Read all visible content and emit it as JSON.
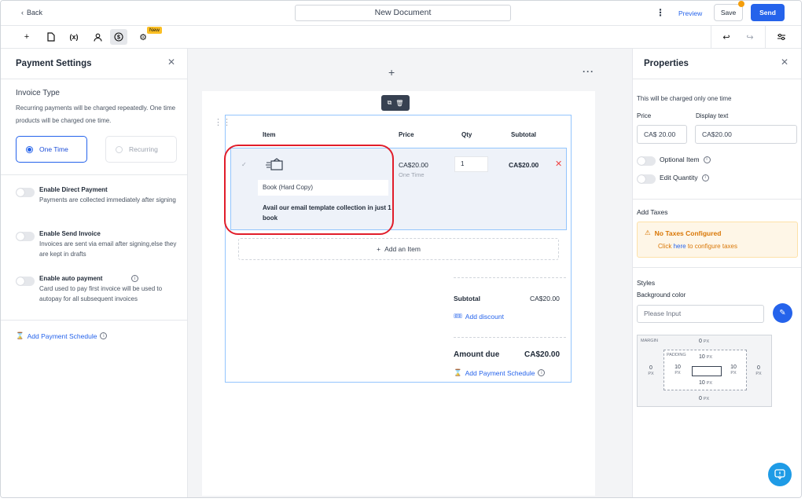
{
  "topbar": {
    "back_label": "Back",
    "document_title": "New Document",
    "preview_label": "Preview",
    "save_label": "Save",
    "send_label": "Send"
  },
  "toolbar": {
    "tools": [
      "plus-icon",
      "page-icon",
      "variable-icon",
      "user-icon",
      "dollar-icon",
      "gear-icon"
    ],
    "variable_glyph": "(x)",
    "new_badge": "New"
  },
  "payment_settings": {
    "title": "Payment Settings",
    "invoice_type_title": "Invoice Type",
    "invoice_type_desc": "Recurring payments will be charged repeatedly. One time products will be charged one time.",
    "option_one_time": "One Time",
    "option_recurring": "Recurring",
    "toggles": [
      {
        "label": "Enable Direct Payment",
        "desc": "Payments are collected immediately after signing"
      },
      {
        "label": "Enable Send Invoice",
        "desc": "Invoices are sent via email after signing,else they are kept in drafts"
      },
      {
        "label": "Enable auto payment",
        "desc": "Card used to pay first invoice will be used to autopay for all subsequent invoices"
      }
    ],
    "add_schedule_label": "Add Payment Schedule"
  },
  "product_table": {
    "headers": {
      "item": "Item",
      "price": "Price",
      "qty": "Qty",
      "subtotal": "Subtotal"
    },
    "rows": [
      {
        "name": "Book (Hard Copy)",
        "description": "Avail our email template collection in just 1 book",
        "price": "CA$20.00",
        "price_type": "One Time",
        "qty": "1",
        "subtotal": "CA$20.00"
      }
    ],
    "add_item_label": "Add an Item",
    "subtotal_label": "Subtotal",
    "subtotal_value": "CA$20.00",
    "add_discount_label": "Add discount",
    "amount_due_label": "Amount due",
    "amount_due_value": "CA$20.00",
    "add_schedule_label": "Add Payment Schedule"
  },
  "properties": {
    "title": "Properties",
    "note": "This will be charged only one time",
    "price_label": "Price",
    "price_value": "CA$ 20.00",
    "display_text_label": "Display text",
    "display_text_value": "CA$20.00",
    "optional_item_label": "Optional Item",
    "edit_quantity_label": "Edit Quantity",
    "add_taxes_title": "Add Taxes",
    "no_taxes_label": "No Taxes Configured",
    "click_prefix": "Click",
    "here_link": "here",
    "configure_suffix": "to configure taxes",
    "styles_title": "Styles",
    "background_color_label": "Background color",
    "background_placeholder": "Please Input",
    "box_model": {
      "margin_label": "MARGIN",
      "padding_label": "PADDING",
      "margin_top": "0",
      "margin_right": "0",
      "margin_bottom": "0",
      "margin_left": "0",
      "padding_top": "10",
      "padding_right": "10",
      "padding_bottom": "10",
      "padding_left": "10",
      "unit": "PX"
    }
  },
  "colors": {
    "accent": "#2563eb",
    "warning": "#d97706",
    "highlight_ring": "#e11d2a"
  }
}
